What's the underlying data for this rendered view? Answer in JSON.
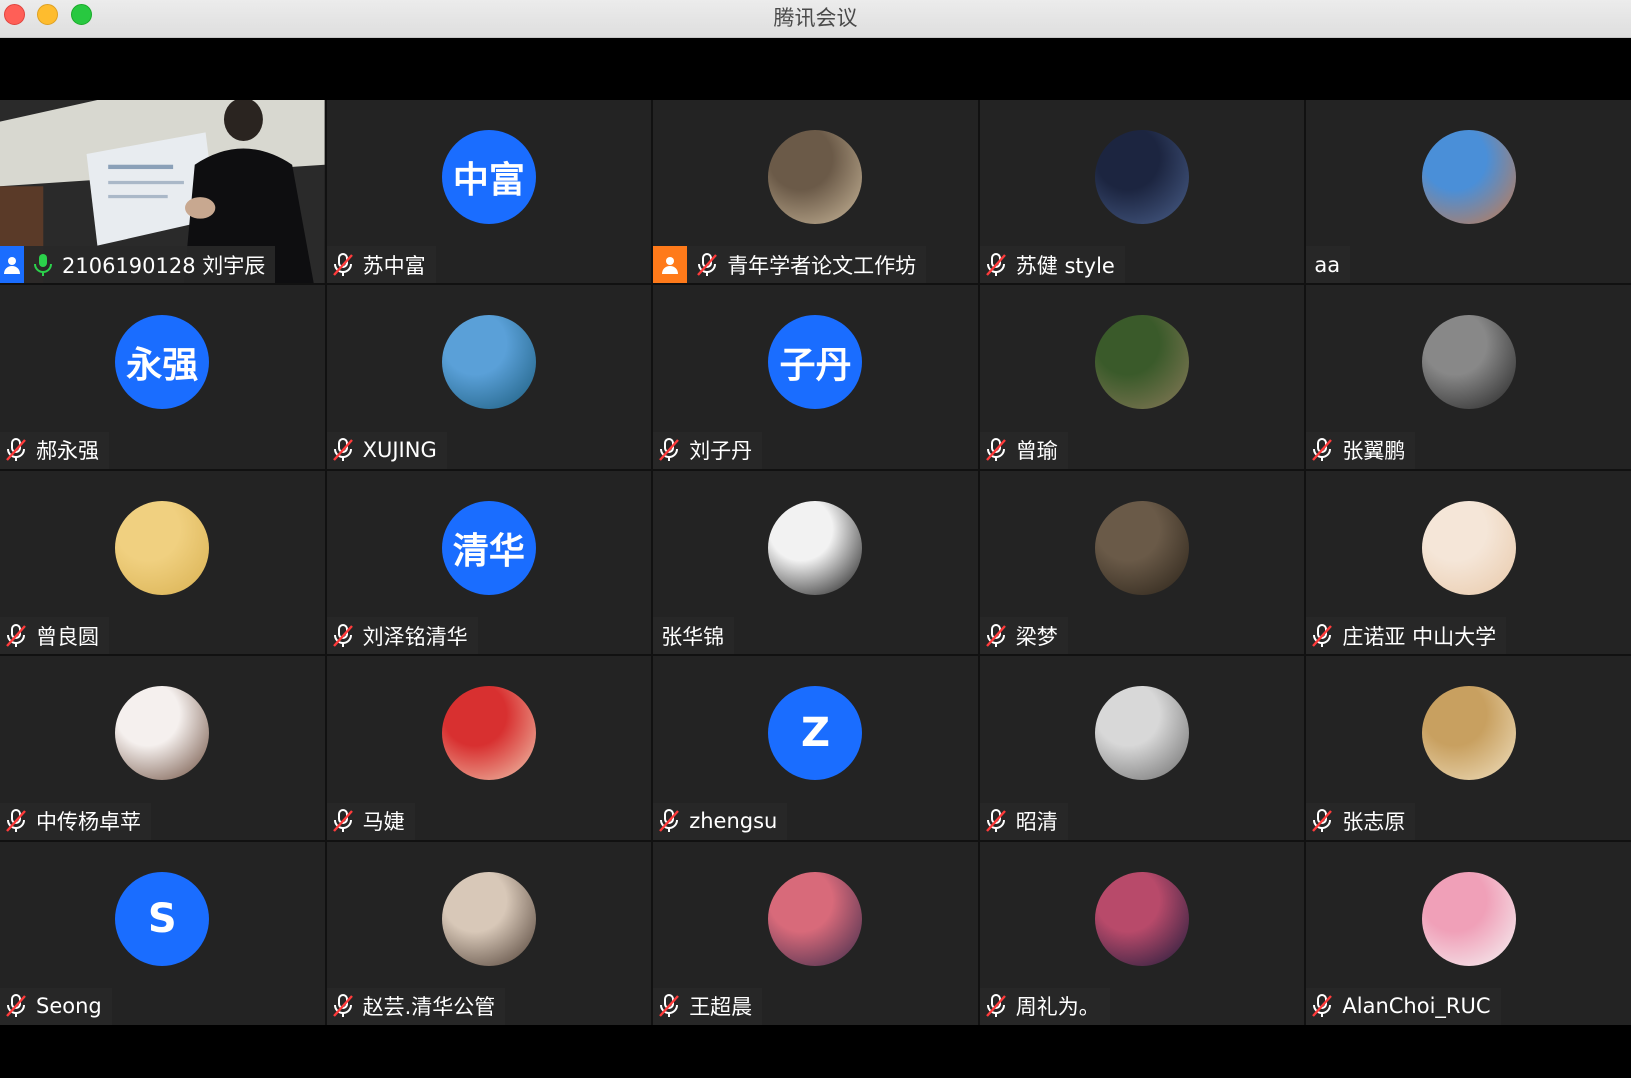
{
  "window": {
    "title": "腾讯会议"
  },
  "participants": [
    {
      "name": "2106190128 刘宇辰",
      "avatar_type": "video",
      "mic": "on",
      "badge": "host-icon",
      "active": true
    },
    {
      "name": "苏中富",
      "avatar_type": "text",
      "avatar_text": "中富",
      "mic": "off"
    },
    {
      "name": "青年学者论文工作坊",
      "avatar_type": "photo",
      "mic": "off",
      "badge": "user-icon",
      "photo_colors": [
        "#6b5a48",
        "#c9b79a"
      ]
    },
    {
      "name": "苏健 style",
      "avatar_type": "photo",
      "mic": "off",
      "photo_colors": [
        "#1c2540",
        "#4a5f8a"
      ]
    },
    {
      "name": "aa",
      "avatar_type": "photo",
      "mic": "none",
      "photo_colors": [
        "#4a8fd8",
        "#c97a4a"
      ]
    },
    {
      "name": "郝永强",
      "avatar_type": "text",
      "avatar_text": "永强",
      "mic": "off"
    },
    {
      "name": "XUJING",
      "avatar_type": "photo",
      "mic": "off",
      "photo_colors": [
        "#5aa0d8",
        "#1a5a7a"
      ]
    },
    {
      "name": "刘子丹",
      "avatar_type": "text",
      "avatar_text": "子丹",
      "mic": "off"
    },
    {
      "name": "曾瑜",
      "avatar_type": "photo",
      "mic": "off",
      "photo_colors": [
        "#3a5a2a",
        "#8a7a5a"
      ]
    },
    {
      "name": "张翼鹏",
      "avatar_type": "photo",
      "mic": "off",
      "photo_colors": [
        "#888888",
        "#222222"
      ]
    },
    {
      "name": "曾良圆",
      "avatar_type": "photo",
      "mic": "off",
      "photo_colors": [
        "#f0d080",
        "#d8b050"
      ]
    },
    {
      "name": "刘泽铭清华",
      "avatar_type": "text",
      "avatar_text": "清华",
      "mic": "off"
    },
    {
      "name": "张华锦",
      "avatar_type": "photo",
      "mic": "none",
      "photo_colors": [
        "#f2f2f2",
        "#111111"
      ]
    },
    {
      "name": "梁梦",
      "avatar_type": "photo",
      "mic": "off",
      "photo_colors": [
        "#6a5a48",
        "#2a2218"
      ]
    },
    {
      "name": "庄诺亚 中山大学",
      "avatar_type": "photo",
      "mic": "off",
      "photo_colors": [
        "#f5e6d8",
        "#e8c8a8"
      ]
    },
    {
      "name": "中传杨卓苹",
      "avatar_type": "photo",
      "mic": "off",
      "photo_colors": [
        "#f5f0ee",
        "#6a4a3a"
      ]
    },
    {
      "name": "马婕",
      "avatar_type": "photo",
      "mic": "off",
      "photo_colors": [
        "#d83030",
        "#f0c8b0"
      ]
    },
    {
      "name": "zhengsu",
      "avatar_type": "letter",
      "avatar_text": "Z",
      "mic": "off"
    },
    {
      "name": "昭清",
      "avatar_type": "photo",
      "mic": "off",
      "photo_colors": [
        "#d8d8d8",
        "#6a6a6a"
      ]
    },
    {
      "name": "张志原",
      "avatar_type": "photo",
      "mic": "off",
      "photo_colors": [
        "#c8a060",
        "#f0e0c0"
      ]
    },
    {
      "name": "Seong",
      "avatar_type": "letter",
      "avatar_text": "S",
      "mic": "off"
    },
    {
      "name": "赵芸.清华公管",
      "avatar_type": "photo",
      "mic": "off",
      "photo_colors": [
        "#d8c8b8",
        "#4a3a30"
      ]
    },
    {
      "name": "王超晨",
      "avatar_type": "photo",
      "mic": "off",
      "photo_colors": [
        "#d86a7a",
        "#3a2a4a"
      ]
    },
    {
      "name": "周礼为。",
      "avatar_type": "photo",
      "mic": "off",
      "photo_colors": [
        "#b84a6a",
        "#1a1a3a"
      ]
    },
    {
      "name": "AlanChoi_RUC",
      "avatar_type": "photo",
      "mic": "off",
      "photo_colors": [
        "#f0a0b8",
        "#f5f5f5"
      ]
    }
  ],
  "colors": {
    "active_border": "#2bd14b",
    "avatar_blue": "#1a6dff",
    "tile_bg": "#232323"
  }
}
